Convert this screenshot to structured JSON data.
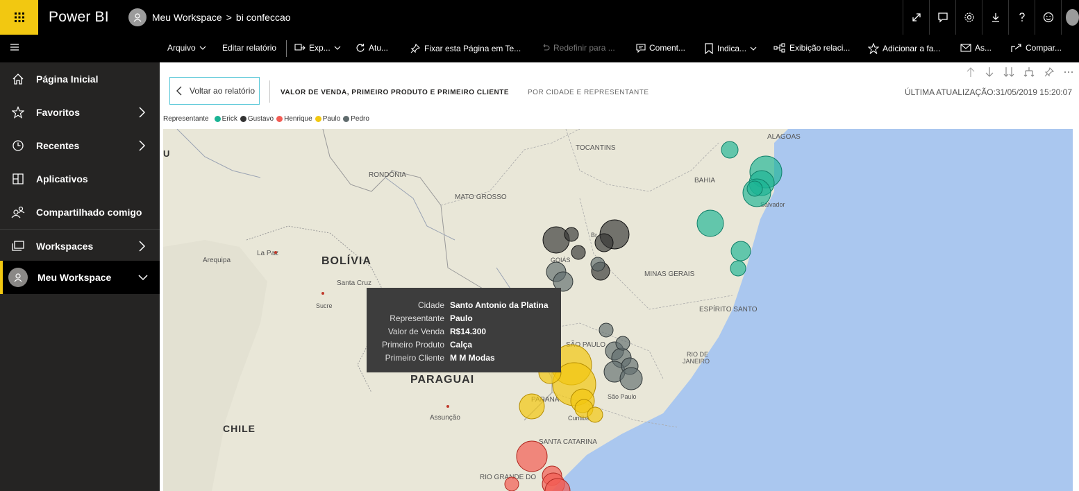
{
  "topbar": {
    "app_title": "Power BI",
    "workspace": "Meu Workspace",
    "separator": ">",
    "report": "bi confeccao"
  },
  "commands": {
    "arquivo": "Arquivo",
    "editar": "Editar relatório",
    "exportar": "Exp...",
    "atualizar": "Atu...",
    "fixar": "Fixar esta Página em Te...",
    "redefinir": "Redefinir para ...",
    "comentarios": "Coment...",
    "indicadores": "Indica...",
    "exibicao": "Exibição relaci...",
    "adicionar": "Adicionar a fa...",
    "assinar": "As...",
    "compartilhar": "Compar..."
  },
  "sidebar": {
    "items": [
      {
        "label": "Página Inicial",
        "icon": "home-icon"
      },
      {
        "label": "Favoritos",
        "icon": "star-icon"
      },
      {
        "label": "Recentes",
        "icon": "clock-icon"
      },
      {
        "label": "Aplicativos",
        "icon": "apps-icon"
      },
      {
        "label": "Compartilhado comigo",
        "icon": "shared-icon"
      },
      {
        "label": "Workspaces",
        "icon": "workspaces-icon"
      },
      {
        "label": "Meu Workspace",
        "icon": "avatar-icon"
      }
    ]
  },
  "report": {
    "back_label": "Voltar ao relatório",
    "title": "VALOR DE VENDA, PRIMEIRO PRODUTO E PRIMEIRO CLIENTE",
    "subtitle": "POR CIDADE E REPRESENTANTE",
    "last_update": "ÚLTIMA ATUALIZAÇÃO:31/05/2019 15:20:07"
  },
  "legend": {
    "title": "Representante",
    "items": [
      {
        "name": "Erick",
        "color": "#1ab394"
      },
      {
        "name": "Gustavo",
        "color": "#333333"
      },
      {
        "name": "Henrique",
        "color": "#f25c54"
      },
      {
        "name": "Paulo",
        "color": "#f2c811"
      },
      {
        "name": "Pedro",
        "color": "#5f6b6d"
      }
    ]
  },
  "map_labels": {
    "u": "U",
    "rondonia": "RONDÔNIA",
    "mato_grosso": "MATO GROSSO",
    "tocantins": "TOCANTINS",
    "bahia": "BAHIA",
    "alagoas": "ALAGOAS",
    "salvador": "Salvador",
    "bolivia": "BOLÍVIA",
    "la_paz": "La Paz",
    "arequipa": "Arequipa",
    "santa_cruz": "Santa Cruz",
    "sucre": "Sucre",
    "goias": "GOIÁS",
    "brasilia": "Br",
    "minas_gerais": "MINAS GERAIS",
    "espirito_santo": "ESPÍRITO SANTO",
    "sao_paulo": "SÃO PAULO",
    "sao_paulo_city": "São Paulo",
    "rio_de_janeiro_1": "RIO DE",
    "rio_de_janeiro_2": "JANEIRO",
    "paraguai": "PARAGUAI",
    "parana": "PARANÁ",
    "curitiba": "Curitiba",
    "assuncao": "Assunção",
    "chile": "CHILE",
    "santa_catarina": "SANTA CATARINA",
    "rio_grande": "RIO GRANDE DO"
  },
  "tooltip": {
    "rows": [
      {
        "label": "Cidade",
        "value": "Santo Antonio da Platina"
      },
      {
        "label": "Representante",
        "value": "Paulo"
      },
      {
        "label": "Valor de Venda",
        "value": "R$14.300"
      },
      {
        "label": "Primeiro Produto",
        "value": "Calça"
      },
      {
        "label": "Primeiro Cliente",
        "value": "M M Modas"
      }
    ]
  }
}
